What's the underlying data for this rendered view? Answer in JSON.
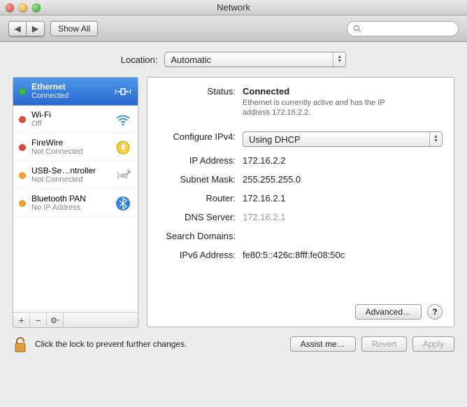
{
  "window": {
    "title": "Network"
  },
  "toolbar": {
    "show_all": "Show All",
    "search_placeholder": ""
  },
  "location": {
    "label": "Location:",
    "value": "Automatic"
  },
  "interfaces": [
    {
      "name": "Ethernet",
      "state": "Connected",
      "color": "#3bbf3b",
      "icon": "ethernet",
      "selected": true
    },
    {
      "name": "Wi-Fi",
      "state": "Off",
      "color": "#e24a3e",
      "icon": "wifi",
      "selected": false
    },
    {
      "name": "FireWire",
      "state": "Not Connected",
      "color": "#e24a3e",
      "icon": "firewire",
      "selected": false
    },
    {
      "name": "USB-Se…ntroller",
      "state": "Not Connected",
      "color": "#f0a62c",
      "icon": "usb",
      "selected": false
    },
    {
      "name": "Bluetooth PAN",
      "state": "No IP Address",
      "color": "#f0a62c",
      "icon": "bluetooth",
      "selected": false
    }
  ],
  "detail": {
    "status_label": "Status:",
    "status_value": "Connected",
    "status_sub": "Ethernet is currently active and has the IP address 172.16.2.2.",
    "config_label": "Configure IPv4:",
    "config_value": "Using DHCP",
    "ip_label": "IP Address:",
    "ip_value": "172.16.2.2",
    "mask_label": "Subnet Mask:",
    "mask_value": "255.255.255.0",
    "router_label": "Router:",
    "router_value": "172.16.2.1",
    "dns_label": "DNS Server:",
    "dns_value": "172.16.2.1",
    "search_label": "Search Domains:",
    "search_value": "",
    "ipv6_label": "IPv6 Address:",
    "ipv6_value": "fe80:5::426c:8fff:fe08:50c",
    "advanced": "Advanced…"
  },
  "footer": {
    "lock_text": "Click the lock to prevent further changes.",
    "assist": "Assist me…",
    "revert": "Revert",
    "apply": "Apply"
  }
}
